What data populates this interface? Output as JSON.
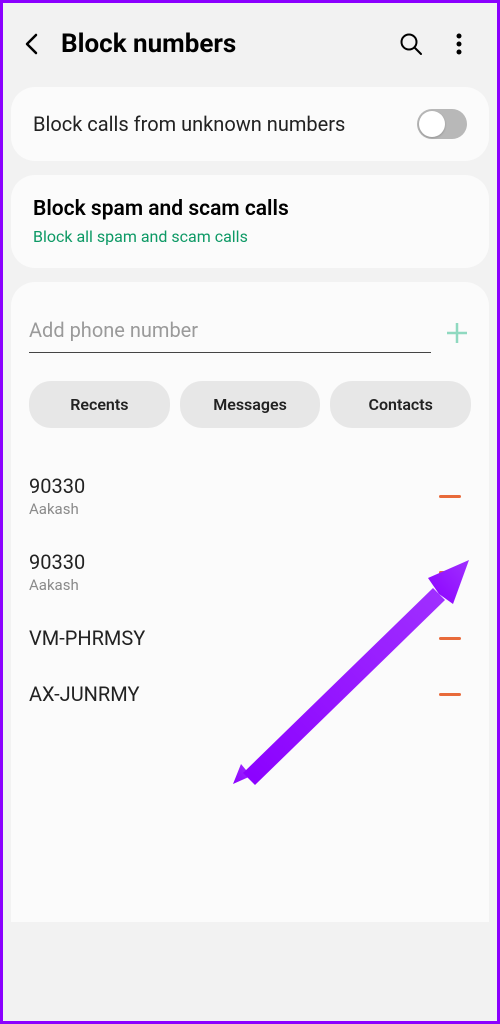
{
  "header": {
    "title": "Block numbers"
  },
  "unknown_card": {
    "label": "Block calls from unknown numbers",
    "enabled": false
  },
  "spam_card": {
    "title": "Block spam and scam calls",
    "subtitle": "Block all spam and scam calls"
  },
  "input": {
    "placeholder": "Add phone number"
  },
  "chips": {
    "recents": "Recents",
    "messages": "Messages",
    "contacts": "Contacts"
  },
  "blocked": [
    {
      "number": "90330",
      "name": "Aakash"
    },
    {
      "number": "90330",
      "name": "Aakash"
    },
    {
      "number": "VM-PHRMSY",
      "name": ""
    },
    {
      "number": "AX-JUNRMY",
      "name": ""
    }
  ]
}
